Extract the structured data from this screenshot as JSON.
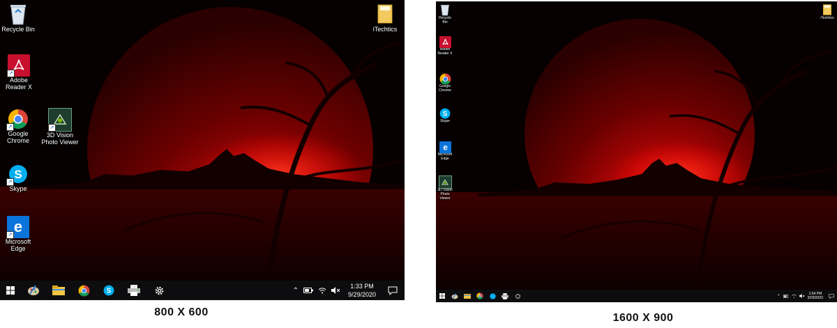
{
  "left_screen": {
    "caption": "800 X 600",
    "icons": [
      {
        "label": "Recycle Bin",
        "icon": "recycle-bin-icon"
      },
      {
        "label": "Adobe Reader X",
        "icon": "adobe-reader-icon"
      },
      {
        "label": "Google Chrome",
        "icon": "chrome-icon"
      },
      {
        "label": "3D Vision Photo Viewer",
        "icon": "3d-vision-icon"
      },
      {
        "label": "Skype",
        "icon": "skype-icon"
      },
      {
        "label": "Microsoft Edge",
        "icon": "edge-icon"
      },
      {
        "label": "iTechtics",
        "icon": "folder-icon"
      }
    ],
    "taskbar": {
      "time": "1:33 PM",
      "date": "9/29/2020"
    }
  },
  "right_screen": {
    "caption": "1600 X 900",
    "icons": [
      {
        "label": "Recycle Bin",
        "icon": "recycle-bin-icon"
      },
      {
        "label": "Adobe Reader X",
        "icon": "adobe-reader-icon"
      },
      {
        "label": "Google Chrome",
        "icon": "chrome-icon"
      },
      {
        "label": "Skype",
        "icon": "skype-icon"
      },
      {
        "label": "Microsoft Edge",
        "icon": "edge-icon"
      },
      {
        "label": "3D Vision Photo Viewer",
        "icon": "3d-vision-icon"
      },
      {
        "label": "iTechtics",
        "icon": "folder-icon"
      }
    ],
    "taskbar": {
      "time": "1:54 PM",
      "date": "9/29/2020"
    }
  },
  "colors": {
    "moon": "#8a0000",
    "glow": "#e01010",
    "taskbar": "#0d0d0f",
    "caption": "#111111"
  }
}
